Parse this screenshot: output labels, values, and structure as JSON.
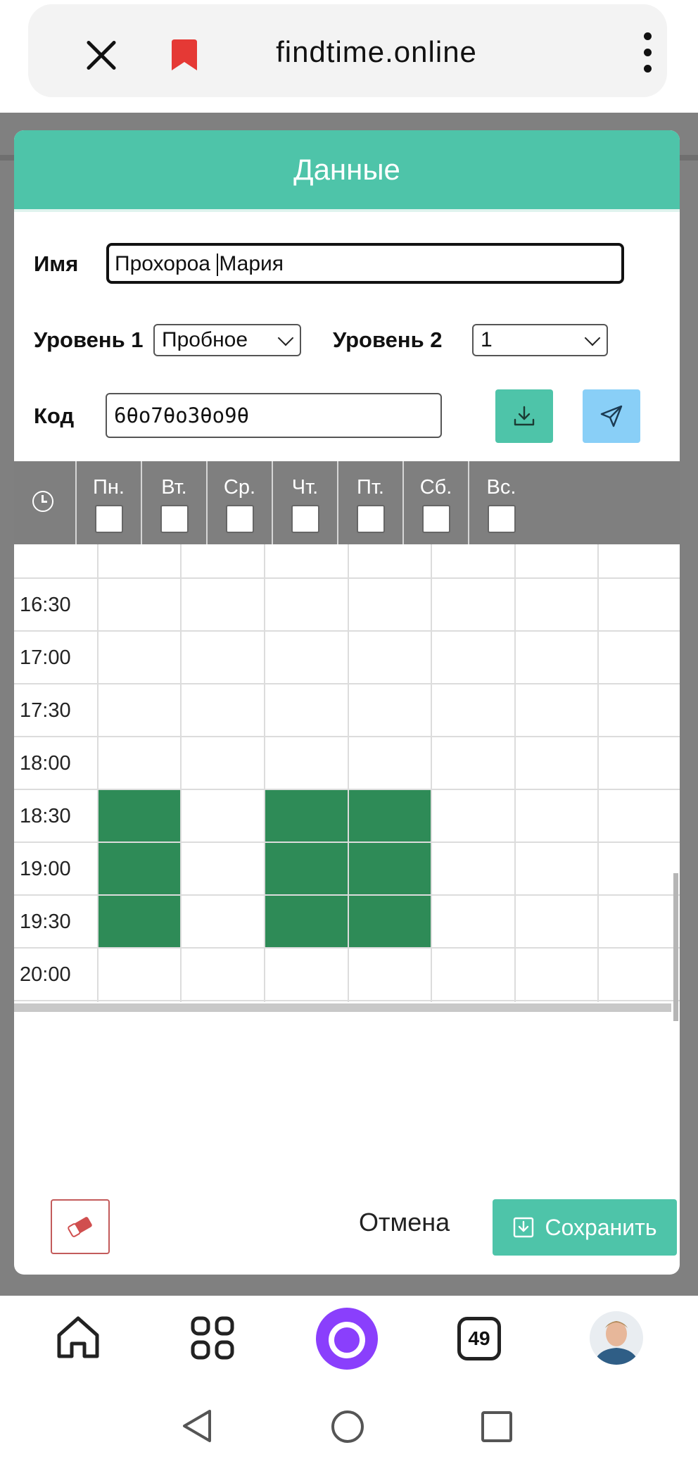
{
  "browser": {
    "url": "findtime.online"
  },
  "modal": {
    "title": "Данные",
    "name_label": "Имя",
    "name_value_before_caret": "Прохороа ",
    "name_value_after_caret": "Мария",
    "level1_label": "Уровень 1",
    "level1_value": "Пробное",
    "level2_label": "Уровень 2",
    "level2_value": "1",
    "code_label": "Код",
    "code_value": "6θo7θo3θo9θ"
  },
  "schedule": {
    "days": [
      "Пн.",
      "Вт.",
      "Ср.",
      "Чт.",
      "Пт.",
      "Сб.",
      "Вс."
    ],
    "times": [
      "16:30",
      "17:00",
      "17:30",
      "18:00",
      "18:30",
      "19:00",
      "19:30",
      "20:00"
    ],
    "selected_slots": [
      {
        "day": "Пн.",
        "time": "18:30"
      },
      {
        "day": "Пн.",
        "time": "19:00"
      },
      {
        "day": "Пн.",
        "time": "19:30"
      },
      {
        "day": "Ср.",
        "time": "18:30"
      },
      {
        "day": "Ср.",
        "time": "19:00"
      },
      {
        "day": "Ср.",
        "time": "19:30"
      },
      {
        "day": "Чт.",
        "time": "18:30"
      },
      {
        "day": "Чт.",
        "time": "19:00"
      },
      {
        "day": "Чт.",
        "time": "19:30"
      }
    ],
    "selected_color": "#2e8b57"
  },
  "footer": {
    "cancel_label": "Отмена",
    "save_label": "Сохранить"
  },
  "navbar": {
    "tabs_count": "49"
  },
  "colors": {
    "accent": "#4ec4a9",
    "send_button": "#89cff7",
    "bookmark": "#e53935",
    "assistant": "#8a3ffc"
  }
}
